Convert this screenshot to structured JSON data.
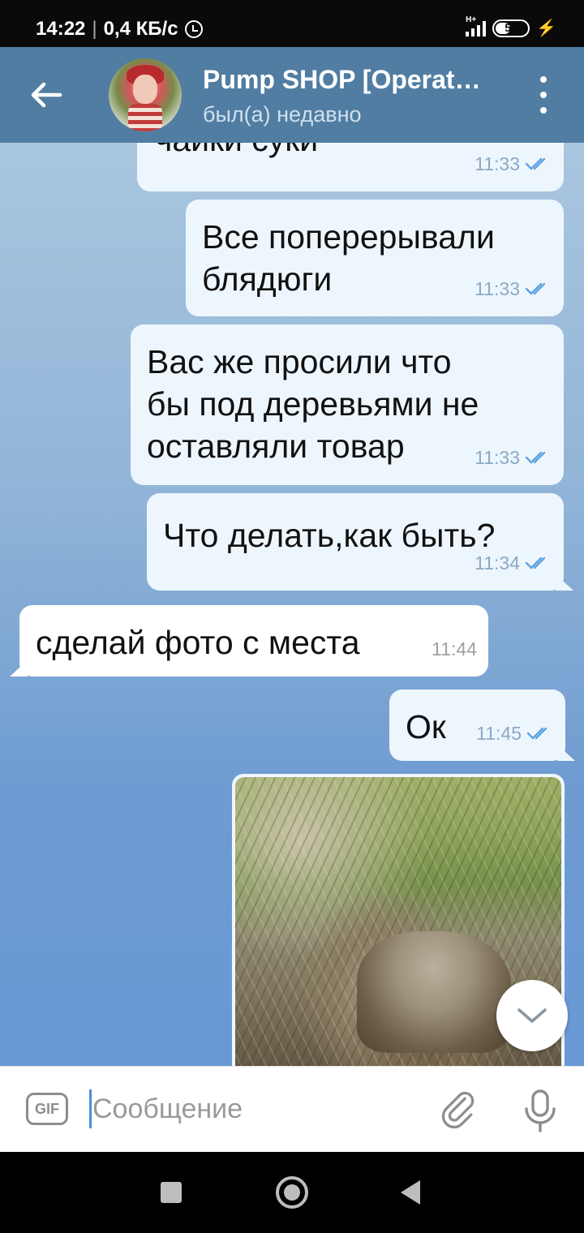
{
  "status_bar": {
    "time": "14:22",
    "separator": "|",
    "speed": "0,4 КБ/с",
    "network_type": "H+",
    "battery_level": "52",
    "battery_percent": 52
  },
  "header": {
    "title": "Pump SHOP [Operat…",
    "status": "был(а) недавно"
  },
  "messages": [
    {
      "direction": "out",
      "text_lines": [
        "чайки суки"
      ],
      "time": "11:33",
      "read": true
    },
    {
      "direction": "out",
      "text_lines": [
        "Все поперерывали",
        "блядюги"
      ],
      "time": "11:33",
      "read": true
    },
    {
      "direction": "out",
      "text_lines": [
        "Вас же просили что",
        "бы под деревьями не",
        "оставляли товар"
      ],
      "time": "11:33",
      "read": true
    },
    {
      "direction": "out",
      "text_lines": [
        "Что делать,как быть?"
      ],
      "time": "11:34",
      "read": true
    },
    {
      "direction": "in",
      "text_lines": [
        "сделай фото с места"
      ],
      "time": "11:44"
    },
    {
      "direction": "out",
      "text_lines": [
        "Ок"
      ],
      "time": "11:45",
      "read": true
    },
    {
      "direction": "out",
      "type": "photo"
    }
  ],
  "input": {
    "gif_label": "GIF",
    "placeholder": "Сообщение",
    "value": ""
  },
  "colors": {
    "header_bg": "#517da2",
    "outgoing_bubble": "#eef6fd",
    "incoming_bubble": "#ffffff",
    "read_check": "#5ea3e0"
  }
}
